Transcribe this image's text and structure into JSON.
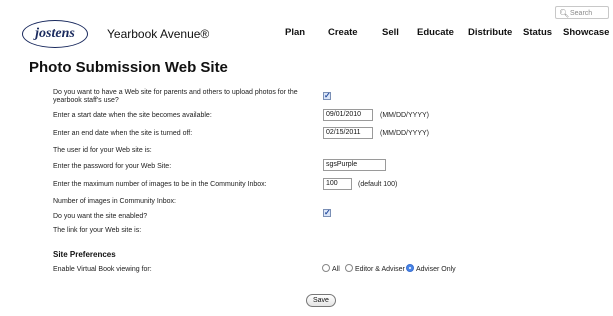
{
  "header": {
    "logo_text": "jostens",
    "brand": "Yearbook Avenue®",
    "search_placeholder": "Search",
    "nav": [
      "Plan",
      "Create",
      "Sell",
      "Educate",
      "Distribute",
      "Status",
      "Showcase"
    ]
  },
  "page_title": "Photo Submission Web Site",
  "form": {
    "q_enable": "Do you want to have a Web site for parents and others to upload photos for the yearbook staff's use?",
    "start_label": "Enter a start date when the site becomes available:",
    "start_value": "09/01/2010",
    "date_hint": "(MM/DD/YYYY)",
    "end_label": "Enter an end date when the site is turned off:",
    "end_value": "02/15/2011",
    "userid_label": "The user id for your Web site is:",
    "password_label": "Enter the password for your Web Site:",
    "password_value": "sgsPurple",
    "max_label": "Enter the maximum number of images to be in the Community Inbox:",
    "max_value": "100",
    "max_hint": "(default 100)",
    "count_label": "Number of images in Community Inbox:",
    "enabled_label": "Do you want the site enabled?",
    "link_label": "The link for your Web site is:"
  },
  "prefs": {
    "title": "Site Preferences",
    "virtual_label": "Enable Virtual Book viewing for:",
    "options": [
      "All",
      "Editor & Adviser",
      "Adviser Only"
    ],
    "selected": "Adviser Only"
  },
  "save_label": "Save"
}
